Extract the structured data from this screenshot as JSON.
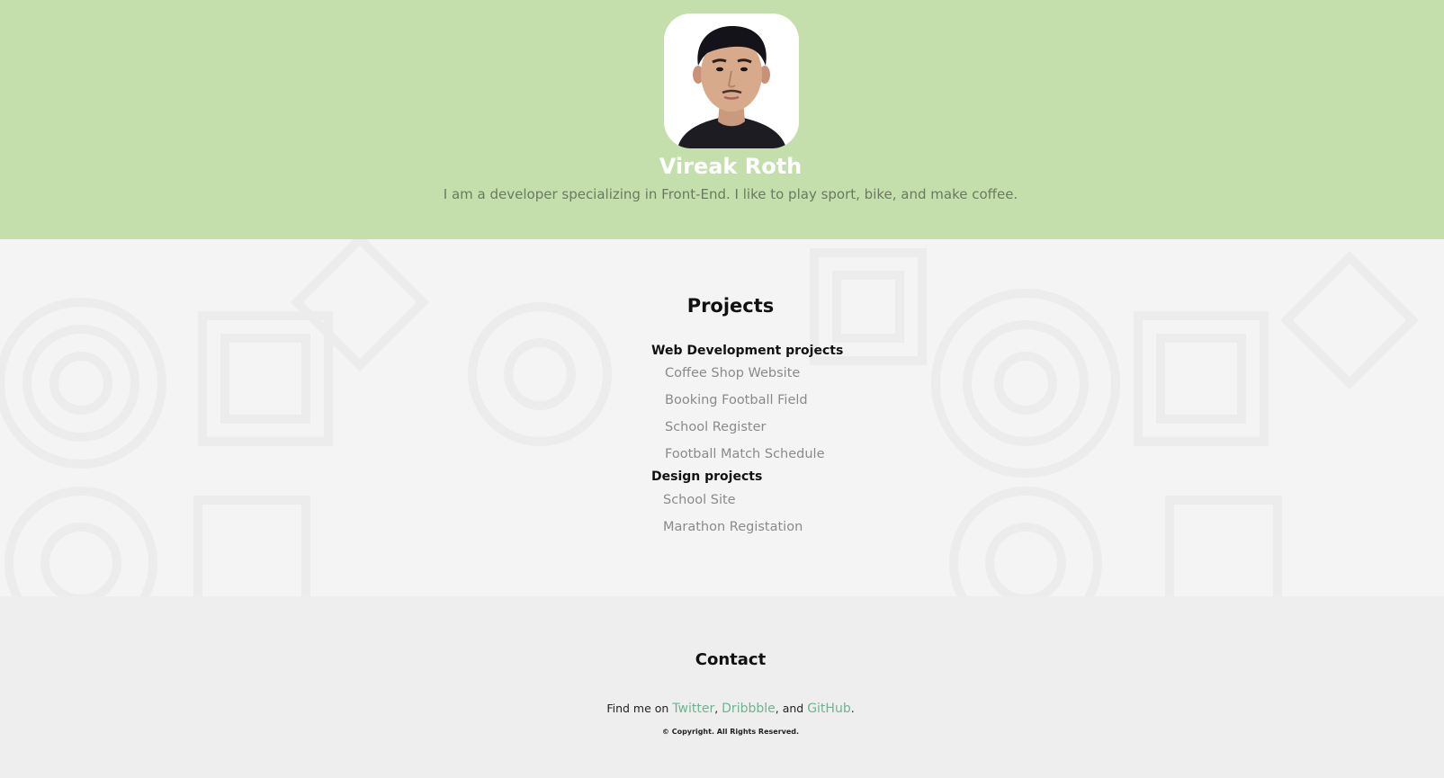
{
  "profile": {
    "name": "Vireak Roth",
    "bio": "I am a developer specializing in Front-End. I like to play sport, bike, and make coffee."
  },
  "projects": {
    "title": "Projects",
    "groups": [
      {
        "title": "Web Development projects",
        "items": [
          "Coffee Shop Website",
          "Booking Football Field",
          "School Register",
          "Football Match Schedule"
        ]
      },
      {
        "title": "Design projects",
        "items": [
          "School Site",
          "Marathon Registation"
        ]
      }
    ]
  },
  "contact": {
    "title": "Contact",
    "find_prefix": "Find me on ",
    "links": [
      "Twitter",
      "Dribbble",
      "GitHub"
    ],
    "sep1": ", ",
    "sep2": ", and ",
    "end": ".",
    "copyright": "© Copyright. All Rights Reserved."
  },
  "colors": {
    "header_bg": "#c4dfab",
    "link": "#6fb38e"
  }
}
